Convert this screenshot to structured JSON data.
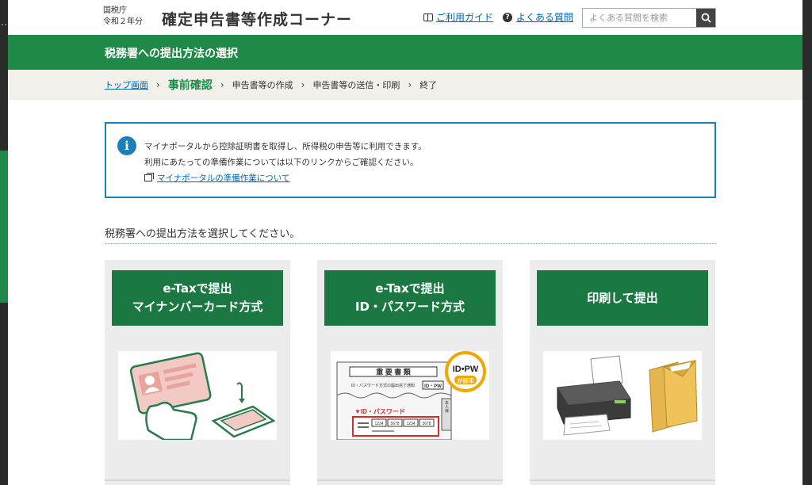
{
  "header": {
    "agency_line1": "国税庁",
    "agency_line2": "令和２年分",
    "site_title": "確定申告書等作成コーナー",
    "guide_link": "ご利用ガイド",
    "faq_link": "よくある質問",
    "search_placeholder": "よくある質問を検索",
    "icons": {
      "guide": "book-icon",
      "faq": "question-icon",
      "search": "search-icon"
    }
  },
  "page_title": "税務署への提出方法の選択",
  "breadcrumb": {
    "items": [
      "トップ画面",
      "事前確認",
      "申告書等の作成",
      "申告書等の送信・印刷",
      "終了"
    ],
    "current_index": 1
  },
  "info": {
    "line1": "マイナポータルから控除証明書を取得し、所得税の申告等に利用できます。",
    "line2": "利用にあたっての準備作業については以下のリンクからご確認ください。",
    "link": "マイナポータルの準備作業について"
  },
  "prompt": "税務署への提出方法を選択してください。",
  "options": [
    {
      "line1": "e-Taxで提出",
      "line2": "マイナンバーカード方式",
      "image": "card-reader-illustration"
    },
    {
      "line1": "e-Taxで提出",
      "line2": "ID・パスワード方式",
      "image": "id-pw-notice-illustration",
      "image_text": {
        "doc_title": "重 要 書 類",
        "doc_subtitle": "ID・パスワード方式の届出完了通知",
        "doc_tag": "ID・PW",
        "badge": "ID•PW",
        "badge_sub": "が目印",
        "red_label": "▼ID・パスワード",
        "id_blocks": [
          "1234",
          "5678",
          "1234",
          "5678"
        ],
        "side": "本人様"
      }
    },
    {
      "line1": "印刷して提出",
      "line2": "",
      "image": "printer-envelope-illustration"
    }
  ],
  "colors": {
    "green": "#1f8a48",
    "card_green": "#1b7842",
    "info_blue": "#1d7fb8",
    "link": "#0067b0"
  }
}
